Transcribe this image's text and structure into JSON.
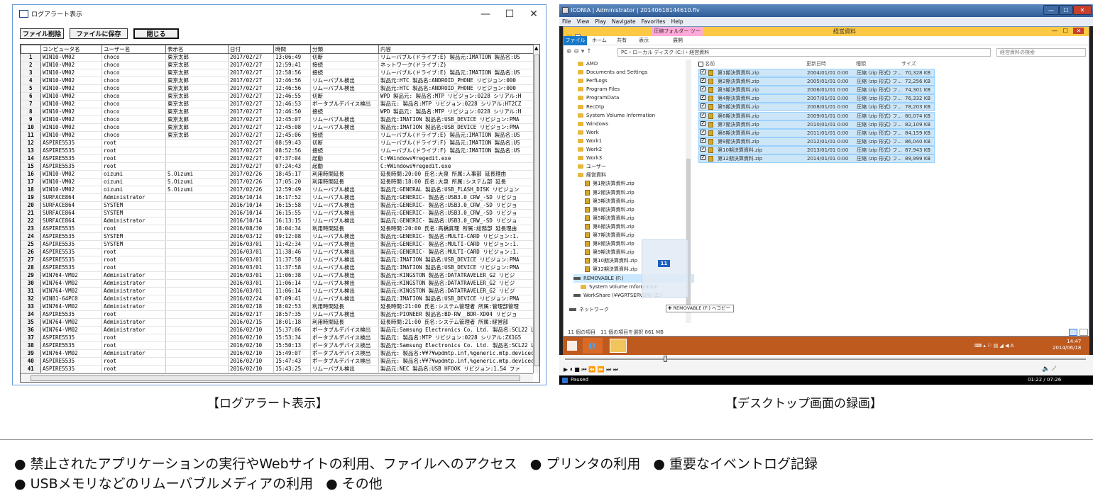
{
  "left_window": {
    "title": "ログアラート表示",
    "controls": {
      "minimize": "—",
      "maximize": "☐",
      "close": "✕"
    },
    "buttons": {
      "delete": "ファイル削除",
      "save": "ファイルに保存",
      "close": "閉じる"
    },
    "columns": [
      "",
      "コンピュータ名",
      "ユーザー名",
      "表示名",
      "日付",
      "時間",
      "分類",
      "内容"
    ],
    "rows": [
      [
        "1",
        "WIN10-VM02",
        "choco",
        "東京太郎",
        "2017/02/27",
        "13:06:49",
        "切断",
        "リムーバブル(ドライブ:E) 製品元:IMATION 製品名:US"
      ],
      [
        "2",
        "WIN10-VM02",
        "choco",
        "東京太郎",
        "2017/02/27",
        "12:59:41",
        "接続",
        "ネットワーク(ドライブ:Z)"
      ],
      [
        "3",
        "WIN10-VM02",
        "choco",
        "東京太郎",
        "2017/02/27",
        "12:58:56",
        "接続",
        "リムーバブル(ドライブ:E) 製品元:IMATION 製品名:US"
      ],
      [
        "4",
        "WIN10-VM02",
        "choco",
        "東京太郎",
        "2017/02/27",
        "12:46:56",
        "リムーバブル検出",
        "製品元:HTC 製品名:ANDROID_PHONE リビジョン:000"
      ],
      [
        "5",
        "WIN10-VM02",
        "choco",
        "東京太郎",
        "2017/02/27",
        "12:46:56",
        "リムーバブル検出",
        "製品元:HTC 製品名:ANDROID_PHONE リビジョン:000"
      ],
      [
        "6",
        "WIN10-VM02",
        "choco",
        "東京太郎",
        "2017/02/27",
        "12:46:55",
        "切断",
        "WPD 製品元: 製品名:MTP リビジョン:0228 シリアル:H"
      ],
      [
        "7",
        "WIN10-VM02",
        "choco",
        "東京太郎",
        "2017/02/27",
        "12:46:53",
        "ポータブルデバイス検出",
        "製品元: 製品名:MTP リビジョン:0228 シリアル:HT2CZ"
      ],
      [
        "8",
        "WIN10-VM02",
        "choco",
        "東京太郎",
        "2017/02/27",
        "12:46:50",
        "接続",
        "WPD 製品元: 製品名:MTP リビジョン:0228 シリアル:H"
      ],
      [
        "9",
        "WIN10-VM02",
        "choco",
        "東京太郎",
        "2017/02/27",
        "12:45:07",
        "リムーバブル検出",
        "製品元:IMATION 製品名:USB_DEVICE リビジョン:PMA"
      ],
      [
        "10",
        "WIN10-VM02",
        "choco",
        "東京太郎",
        "2017/02/27",
        "12:45:08",
        "リムーバブル検出",
        "製品元:IMATION 製品名:USB_DEVICE リビジョン:PMA"
      ],
      [
        "11",
        "WIN10-VM02",
        "choco",
        "東京太郎",
        "2017/02/27",
        "12:45:06",
        "接続",
        "リムーバブル(ドライブ:E) 製品元:IMATION 製品名:US"
      ],
      [
        "12",
        "ASPIRE5535",
        "root",
        "",
        "2017/02/27",
        "08:59:43",
        "切断",
        "リムーバブル(ドライブ:F) 製品元:IMATION 製品名:US"
      ],
      [
        "13",
        "ASPIRE5535",
        "root",
        "",
        "2017/02/27",
        "08:52:56",
        "接続",
        "リムーバブル(ドライブ:F) 製品元:IMATION 製品名:US"
      ],
      [
        "14",
        "ASPIRE5535",
        "root",
        "",
        "2017/02/27",
        "07:37:04",
        "起動",
        "C:¥Windows¥regedit.exe"
      ],
      [
        "15",
        "ASPIRE5535",
        "root",
        "",
        "2017/02/27",
        "07:24:43",
        "起動",
        "C:¥Windows¥regedit.exe"
      ],
      [
        "16",
        "WIN10-VM02",
        "oizumi",
        "S.Oizumi",
        "2017/02/26",
        "18:45:17",
        "利用時間延長",
        "延長時間:20:00 氏名:大泉 所属:人事部 延長理由"
      ],
      [
        "17",
        "WIN10-VM02",
        "oizumi",
        "S.Oizumi",
        "2017/02/26",
        "17:05:20",
        "利用時間延長",
        "延長時間:18:00 氏名:大泉 所属:システム部 延長"
      ],
      [
        "18",
        "WIN10-VM02",
        "oizumi",
        "S.Oizumi",
        "2017/02/26",
        "12:59:49",
        "リムーバブル検出",
        "製品元:GENERAL 製品名:USB_FLASH_DISK リビジョン"
      ],
      [
        "19",
        "SURFACE864",
        "Administrator",
        "",
        "2016/10/14",
        "16:17:52",
        "リムーバブル検出",
        "製品元:GENERIC- 製品名:USB3.0_CRW_-SD リビジョ"
      ],
      [
        "20",
        "SURFACE864",
        "SYSTEM",
        "",
        "2016/10/14",
        "16:15:58",
        "リムーバブル検出",
        "製品元:GENERIC- 製品名:USB3.0_CRW_-SD リビジョ"
      ],
      [
        "21",
        "SURFACE864",
        "SYSTEM",
        "",
        "2016/10/14",
        "16:15:55",
        "リムーバブル検出",
        "製品元:GENERIC- 製品名:USB3.0_CRW_-SD リビジョ"
      ],
      [
        "22",
        "SURFACE864",
        "Administrator",
        "",
        "2016/10/14",
        "16:13:15",
        "リムーバブル検出",
        "製品元:GENERIC- 製品名:USB3.0_CRW_-SD リビジョ"
      ],
      [
        "23",
        "ASPIRE5535",
        "root",
        "",
        "2016/08/30",
        "18:04:34",
        "利用時間延長",
        "延長時間:20:00 氏名:高橋真理 所属:総務部 延長理由"
      ],
      [
        "24",
        "ASPIRE5535",
        "SYSTEM",
        "",
        "2016/03/12",
        "09:12:08",
        "リムーバブル検出",
        "製品元:GENERIC- 製品名:MULTI-CARD リビジョン:1."
      ],
      [
        "25",
        "ASPIRE5535",
        "SYSTEM",
        "",
        "2016/03/01",
        "11:42:34",
        "リムーバブル検出",
        "製品元:GENERIC- 製品名:MULTI-CARD リビジョン:1."
      ],
      [
        "26",
        "ASPIRE5535",
        "root",
        "",
        "2016/03/01",
        "11:38:46",
        "リムーバブル検出",
        "製品元:GENERIC- 製品名:MULTI-CARD リビジョン:1."
      ],
      [
        "27",
        "ASPIRE5535",
        "root",
        "",
        "2016/03/01",
        "11:37:58",
        "リムーバブル検出",
        "製品元:IMATION 製品名:USB_DEVICE リビジョン:PMA"
      ],
      [
        "28",
        "ASPIRE5535",
        "root",
        "",
        "2016/03/01",
        "11:37:58",
        "リムーバブル検出",
        "製品元:IMATION 製品名:USB_DEVICE リビジョン:PMA"
      ],
      [
        "29",
        "WIN764-VM02",
        "Administrator",
        "",
        "2016/03/01",
        "11:06:38",
        "リムーバブル検出",
        "製品元:KINGSTON 製品名:DATATRAVELER_G2 リビジ"
      ],
      [
        "30",
        "WIN764-VM02",
        "Administrator",
        "",
        "2016/03/01",
        "11:06:14",
        "リムーバブル検出",
        "製品元:KINGSTON 製品名:DATATRAVELER_G2 リビジ"
      ],
      [
        "31",
        "WIN764-VM02",
        "Administrator",
        "",
        "2016/03/01",
        "11:06:14",
        "リムーバブル検出",
        "製品元:KINGSTON 製品名:DATATRAVELER_G2 リビジ"
      ],
      [
        "32",
        "WIN81-64PC0",
        "Administrator",
        "",
        "2016/02/24",
        "07:09:41",
        "リムーバブル検出",
        "製品元:IMATION 製品名:USB_DEVICE リビジョン:PMA"
      ],
      [
        "33",
        "WIN764-VM02",
        "Administrator",
        "",
        "2016/02/18",
        "18:02:53",
        "利用時間延長",
        "延長時間:21:00 氏名:システム管理者 所属:管理部管理"
      ],
      [
        "34",
        "ASPIRE5535",
        "root",
        "",
        "2016/02/17",
        "18:57:35",
        "リムーバブル検出",
        "製品元:PIONEER 製品名:BD-RW__BDR-XD04 リビジョ"
      ],
      [
        "35",
        "WIN764-VM02",
        "Administrator",
        "",
        "2016/02/15",
        "18:01:18",
        "利用時間延長",
        "延長時間:21:00 氏名:システム管理者 所属:経営部"
      ],
      [
        "36",
        "WIN764-VM02",
        "Administrator",
        "",
        "2016/02/10",
        "15:37:06",
        "ポータブルデバイス検出",
        "製品元:Samsung Electronics Co. Ltd. 製品名:SCL22 L"
      ],
      [
        "37",
        "ASPIRE5535",
        "root",
        "",
        "2016/02/10",
        "15:53:34",
        "ポータブルデバイス検出",
        "製品元: 製品名:MTP リビジョン:0228 シリアル:ZX1G5"
      ],
      [
        "38",
        "ASPIRE5535",
        "root",
        "",
        "2016/02/10",
        "15:50:13",
        "ポータブルデバイス検出",
        "製品元:Samsung Electronics Co. Ltd. 製品名:SCL22 L"
      ],
      [
        "39",
        "WIN764-VM02",
        "Administrator",
        "",
        "2016/02/10",
        "15:49:07",
        "ポータブルデバイス検出",
        "製品元: 製品名:¥¥?¥wpdmtp.inf,%generic.mtp.devicedesc%"
      ],
      [
        "40",
        "ASPIRE5535",
        "root",
        "",
        "2016/02/10",
        "15:47:43",
        "ポータブルデバイス検出",
        "製品元: 製品名:¥¥?¥wpdmtp.inf,%generic.mtp.devicedesc%"
      ],
      [
        "41",
        "ASPIRE5535",
        "root",
        "",
        "2016/02/10",
        "15:43:25",
        "リムーバブル検出",
        "製品元:NEC 製品名:USB HFOOK リビジョン:1.54 ファ"
      ]
    ]
  },
  "right_window": {
    "title": "ICONIA | Administrator | 20140618144610.flv",
    "controls": {
      "minimize": "—",
      "maximize": "☐",
      "close": "✕"
    },
    "menu": [
      "File",
      "View",
      "Play",
      "Navigate",
      "Favorites",
      "Help"
    ],
    "explorer": {
      "title": "経営資料",
      "tool_tab": "圧縮フォルダー ツール",
      "ribbon_tabs": [
        "ファイル",
        "ホーム",
        "共有",
        "表示",
        "展開"
      ],
      "address": "PC › ローカル ディスク (C:) › 経営資料",
      "search_placeholder": "経営資料の検索",
      "tree_items": [
        "AMD",
        "Documents and Settings",
        "PerfLogs",
        "Program Files",
        "ProgramData",
        "RecDtp",
        "System Volume Information",
        "Windows",
        "Work",
        "Work1",
        "Work2",
        "Work3",
        "ユーザー",
        "経営資料"
      ],
      "tree_zips": [
        "第1期決算資料.zip",
        "第2期決算資料.zip",
        "第3期決算資料.zip",
        "第4期決算資料.zip",
        "第5期決算資料.zip",
        "第6期決算資料.zip",
        "第7期決算資料.zip",
        "第8期決算資料.zip",
        "第9期決算資料.zip",
        "第10期決算資料.zip",
        "第12期決算資料.zip"
      ],
      "tree_removable": "REMOVABLE (F:)",
      "tree_removable_child": "System Volume Information",
      "tree_workshare": "WorkShare (¥¥GRTSERVER) (Z:)",
      "tree_network": "ネットワーク",
      "columns": [
        "名前",
        "更新日時",
        "種類",
        "サイズ"
      ],
      "files": [
        [
          "第1期決算資料.zip",
          "2004/01/01 0:00",
          "圧縮 (zip 形式) フ...",
          "70,328 KB"
        ],
        [
          "第2期決算資料.zip",
          "2005/01/01 0:00",
          "圧縮 (zip 形式) フ...",
          "72,256 KB"
        ],
        [
          "第3期決算資料.zip",
          "2006/01/01 0:00",
          "圧縮 (zip 形式) フ...",
          "74,301 KB"
        ],
        [
          "第4期決算資料.zip",
          "2007/01/01 0:00",
          "圧縮 (zip 形式) フ...",
          "76,332 KB"
        ],
        [
          "第5期決算資料.zip",
          "2008/01/01 0:00",
          "圧縮 (zip 形式) フ...",
          "78,203 KB"
        ],
        [
          "第6期決算資料.zip",
          "2009/01/01 0:00",
          "圧縮 (zip 形式) フ...",
          "80,074 KB"
        ],
        [
          "第7期決算資料.zip",
          "2010/01/01 0:00",
          "圧縮 (zip 形式) フ...",
          "82,109 KB"
        ],
        [
          "第8期決算資料.zip",
          "2011/01/01 0:00",
          "圧縮 (zip 形式) フ...",
          "84,159 KB"
        ],
        [
          "第9期決算資料.zip",
          "2012/01/01 0:00",
          "圧縮 (zip 形式) フ...",
          "86,040 KB"
        ],
        [
          "第10期決算資料.zip",
          "2013/01/01 0:00",
          "圧縮 (zip 形式) フ...",
          "87,943 KB"
        ],
        [
          "第12期決算資料.zip",
          "2014/01/01 0:00",
          "圧縮 (zip 形式) フ...",
          "89,999 KB"
        ]
      ],
      "status": "11 個の項目　11 個の項目を選択 861 MB",
      "drag_count": "11",
      "drag_tip": "✚ REMOVABLE (F:) へコピー"
    },
    "taskbar": {
      "time": "14:47",
      "date": "2014/06/18",
      "tray": "⌨ ▴ ⚐ ▤ ◢ ◀ A"
    },
    "player": {
      "controls": "▶ ⏸ ■  ⏮ ⏪ ⏩ ⏭  ⏭",
      "progress": 0.19
    },
    "status_left": "Paused",
    "status_right": "01:22 / 07:26"
  },
  "captions": {
    "left": "【ログアラート表示】",
    "right": "【デスクトップ画面の録画】"
  },
  "bullets": {
    "line1": [
      "● 禁止されたアプリケーションの実行やWebサイトの利用、ファイルへのアクセス",
      "● プリンタの利用",
      "● 重要なイベントログ記録"
    ],
    "line2": [
      "● USBメモリなどのリムーバブルメディアの利用",
      "● その他"
    ]
  },
  "colors": {
    "accent": "#1979ca",
    "explorer_title": "#fcc945",
    "taskbar": "#bf5a1f",
    "selection": "#cde6f7"
  }
}
